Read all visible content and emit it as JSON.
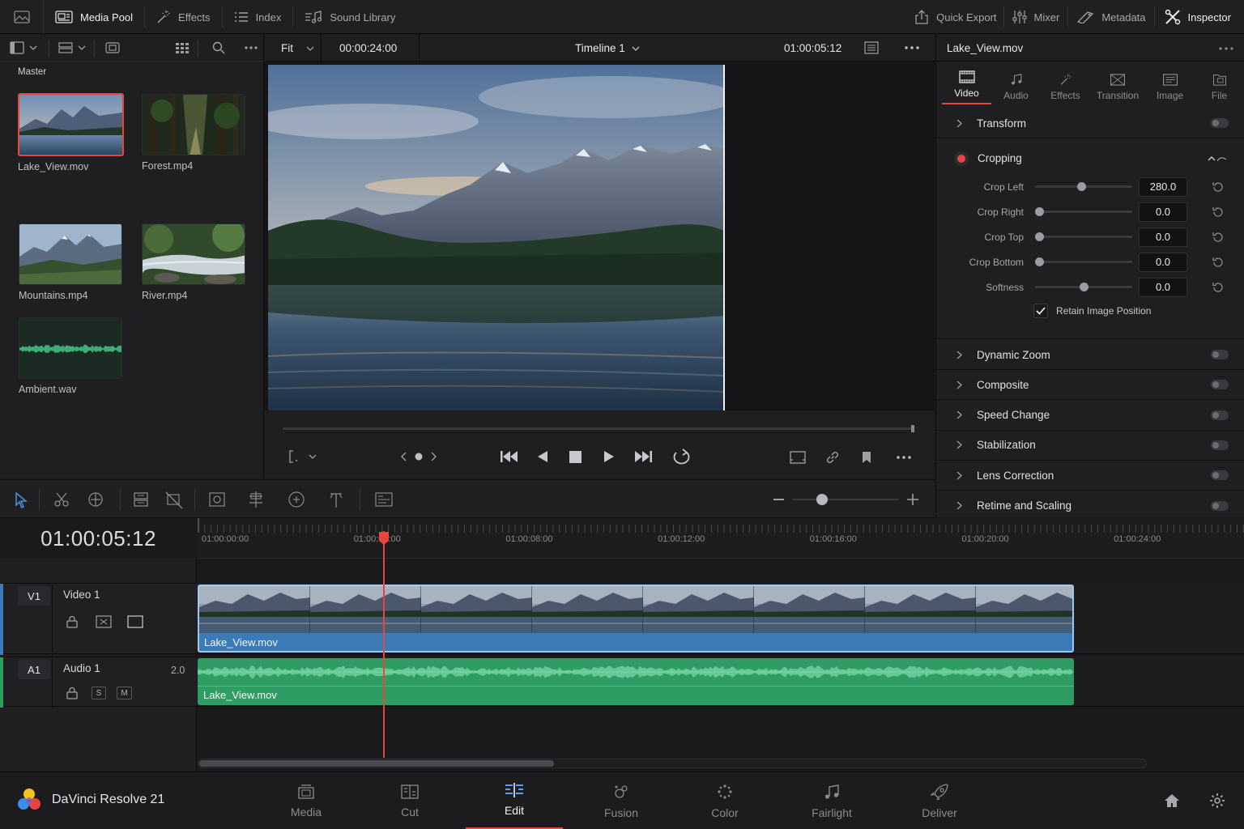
{
  "colors": {
    "accent_red": "#e8453c",
    "video_clip": "#3a7bb8",
    "audio_clip": "#2e9c63",
    "panel": "#1f1f22"
  },
  "topbar": {
    "left_items": [
      {
        "label": "Media Pool",
        "icon": "media-pool-icon",
        "active": true
      },
      {
        "label": "Effects",
        "icon": "effects-wand-icon"
      },
      {
        "label": "Index",
        "icon": "index-list-icon"
      },
      {
        "label": "Sound Library",
        "icon": "sound-library-icon"
      }
    ],
    "right_items": [
      {
        "label": "Quick Export",
        "icon": "export-icon"
      },
      {
        "label": "Mixer",
        "icon": "mixer-icon"
      },
      {
        "label": "Metadata",
        "icon": "metadata-icon"
      },
      {
        "label": "Inspector",
        "icon": "inspector-icon",
        "active": true
      }
    ]
  },
  "media_pool": {
    "folder": "Master",
    "clips": [
      {
        "name": "Lake_View.mov",
        "kind": "lake",
        "selected": true
      },
      {
        "name": "Forest.mp4",
        "kind": "forest"
      },
      {
        "name": "Mountains.mp4",
        "kind": "mountains"
      },
      {
        "name": "River.mp4",
        "kind": "river"
      },
      {
        "name": "Ambient.wav",
        "kind": "audio"
      }
    ]
  },
  "viewer": {
    "zoom": "Fit",
    "duration_tc": "00:00:24:00",
    "timeline_name": "Timeline 1",
    "current_tc": "01:00:05:12"
  },
  "inspector": {
    "clip_name": "Lake_View.mov",
    "tabs": [
      {
        "label": "Video",
        "icon": "video-icon",
        "active": true
      },
      {
        "label": "Audio",
        "icon": "audio-note-icon"
      },
      {
        "label": "Effects",
        "icon": "effects-icon"
      },
      {
        "label": "Transition",
        "icon": "transition-icon"
      },
      {
        "label": "Image",
        "icon": "image-icon"
      },
      {
        "label": "File",
        "icon": "file-icon"
      }
    ],
    "transform_label": "Transform",
    "cropping_label": "Cropping",
    "crop_params": [
      {
        "label": "Crop Left",
        "value": "280.0",
        "level": 0.47
      },
      {
        "label": "Crop Right",
        "value": "0.0",
        "level": 0.0
      },
      {
        "label": "Crop Top",
        "value": "0.0",
        "level": 0.0
      },
      {
        "label": "Crop Bottom",
        "value": "0.0",
        "level": 0.0
      },
      {
        "label": "Softness",
        "value": "0.0",
        "level": 0.5
      }
    ],
    "retain_label": "Retain Image Position",
    "sections": [
      {
        "label": "Dynamic Zoom"
      },
      {
        "label": "Composite"
      },
      {
        "label": "Speed Change"
      },
      {
        "label": "Stabilization"
      },
      {
        "label": "Lens Correction"
      },
      {
        "label": "Retime and Scaling"
      }
    ]
  },
  "timeline": {
    "current_tc": "01:00:05:12",
    "ruler_labels": [
      "01:00:00:00",
      "01:00:04:00",
      "01:00:08:00",
      "01:00:12:00",
      "01:00:16:00",
      "01:00:20:00",
      "01:00:24:00"
    ],
    "zoom_level": 0.28,
    "tracks": {
      "video": {
        "id": "V1",
        "name": "Video 1",
        "clip_name": "Lake_View.mov"
      },
      "audio": {
        "id": "A1",
        "name": "Audio 1",
        "channels": "2.0",
        "solo": "S",
        "mute": "M",
        "clip_name": "Lake_View.mov"
      }
    }
  },
  "app": {
    "name": "DaVinci Resolve 21"
  },
  "pages": [
    {
      "label": "Media",
      "icon": "media-page-icon"
    },
    {
      "label": "Cut",
      "icon": "cut-page-icon"
    },
    {
      "label": "Edit",
      "icon": "edit-page-icon",
      "active": true
    },
    {
      "label": "Fusion",
      "icon": "fusion-page-icon"
    },
    {
      "label": "Color",
      "icon": "color-page-icon"
    },
    {
      "label": "Fairlight",
      "icon": "fairlight-page-icon"
    },
    {
      "label": "Deliver",
      "icon": "deliver-page-icon"
    }
  ]
}
